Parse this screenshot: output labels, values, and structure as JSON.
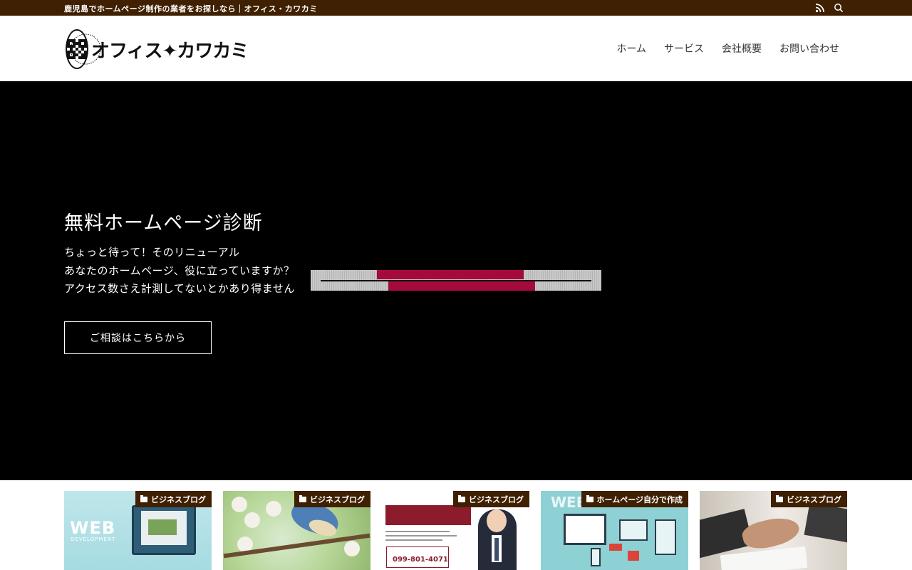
{
  "topbar": {
    "tagline": "鹿児島でホームページ制作の業者をお探しなら｜オフィス・カワカミ",
    "icons": [
      "rss-icon",
      "search-icon"
    ]
  },
  "header": {
    "logo_text": "オフィス✦カワカミ",
    "seal_ring_text": "Office Kawakami",
    "nav": [
      "ホーム",
      "サービス",
      "会社概要",
      "お問い合わせ"
    ]
  },
  "hero": {
    "title": "無料ホームページ診断",
    "lead": [
      "ちょっと待って！そのリニューアル",
      "あなたのホームページ、役に立っていますか？",
      "アクセス数さえ計測してないとかあり得ません"
    ],
    "cta_label": "ご相談はこちらから"
  },
  "cards": [
    {
      "category": "ビジネスブログ",
      "thumb": "web-development-illustration",
      "thumb_text": "WEB",
      "thumb_sub": "DEVELOPMENT"
    },
    {
      "category": "ビジネスブログ",
      "thumb": "bird-on-blossom-photo"
    },
    {
      "category": "ビジネスブログ",
      "thumb": "businessman-flyer",
      "thumb_phone": "099-801-4071"
    },
    {
      "category": "ホームページ自分で作成",
      "thumb": "web-layout-illustration",
      "thumb_text": "WEB"
    },
    {
      "category": "ビジネスブログ",
      "thumb": "handshake-photo"
    }
  ],
  "colors": {
    "brand_brown": "#3f2000",
    "hero_bg": "#000000",
    "banner_accent": "#a50a3c"
  }
}
